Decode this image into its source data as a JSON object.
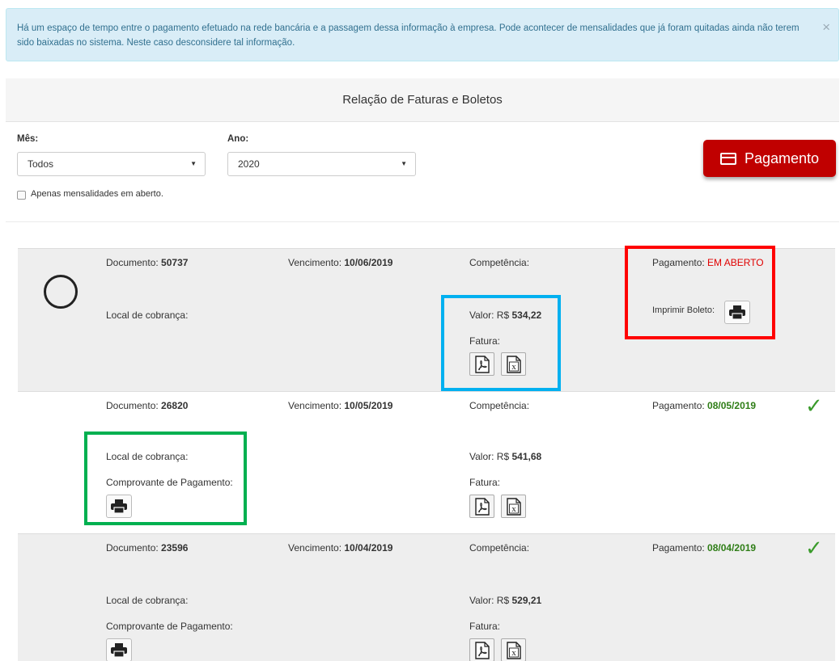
{
  "alert": {
    "text": "Há um espaço de tempo entre o pagamento efetuado na rede bancária e a passagem dessa informação à empresa. Pode acontecer de mensalidades que já foram quitadas ainda não terem sido baixadas no sistema. Neste caso desconsidere tal informação.",
    "close": "×"
  },
  "panel_title": "Relação de Faturas e Boletos",
  "filters": {
    "mes_label": "Mês:",
    "mes_value": "Todos",
    "ano_label": "Ano:",
    "ano_value": "2020",
    "checkbox_label": "Apenas mensalidades em aberto."
  },
  "pay_button": "Pagamento",
  "labels": {
    "documento": "Documento: ",
    "vencimento": "Vencimento: ",
    "competencia": "Competência:",
    "local": "Local de cobrança:",
    "valor": "Valor: R$ ",
    "fatura": "Fatura:",
    "pagamento": "Pagamento: ",
    "imprimir": "Imprimir Boleto:",
    "comprovante": "Comprovante de Pagamento:"
  },
  "invoices": [
    {
      "documento": "50737",
      "vencimento": "10/06/2019",
      "valor": "534,22",
      "pagamento": "EM ABERTO",
      "status": "open"
    },
    {
      "documento": "26820",
      "vencimento": "10/05/2019",
      "valor": "541,68",
      "pagamento": "08/05/2019",
      "status": "paid"
    },
    {
      "documento": "23596",
      "vencimento": "10/04/2019",
      "valor": "529,21",
      "pagamento": "08/04/2019",
      "status": "paid"
    }
  ],
  "colors": {
    "alert_bg": "#d9edf7",
    "pay_button": "#c00000",
    "open_status": "#e00000",
    "paid_status": "#2e7d16",
    "highlight_red": "#ff0000",
    "highlight_blue": "#00b0f0",
    "highlight_green": "#00b050"
  },
  "icons": {
    "printer": "printer-icon",
    "pdf": "pdf-file-icon",
    "excel": "excel-file-icon",
    "check": "checkmark-icon",
    "circle": "open-circle-icon",
    "card": "credit-card-icon",
    "caret": "caret-down-icon"
  }
}
